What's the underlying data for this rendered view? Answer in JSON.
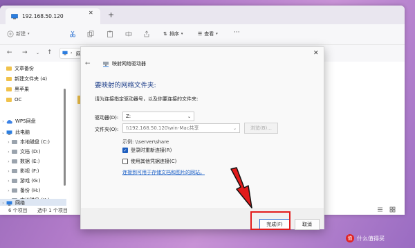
{
  "explorer": {
    "tab_title": "192.168.50.120",
    "new_tab_label": "+",
    "toolbar": {
      "new_label": "新建",
      "sort_label": "排序",
      "view_label": "查看",
      "more_label": "···"
    },
    "breadcrumb_text": "网",
    "sidebar": {
      "items": [
        {
          "label": "文章备份",
          "icon": "folder-icon"
        },
        {
          "label": "新建文件夹 (4)",
          "icon": "folder-icon"
        },
        {
          "label": "黑苹果",
          "icon": "folder-icon"
        },
        {
          "label": "OC",
          "icon": "folder-icon"
        },
        {
          "label": "WPS网盘",
          "icon": "cloud-icon"
        },
        {
          "label": "此电脑",
          "icon": "computer-icon"
        },
        {
          "label": "本地磁盘 (C:)",
          "icon": "drive-icon"
        },
        {
          "label": "文档 (D:)",
          "icon": "drive-icon"
        },
        {
          "label": "数据 (E:)",
          "icon": "drive-icon"
        },
        {
          "label": "影视 (F:)",
          "icon": "drive-icon"
        },
        {
          "label": "游戏 (G:)",
          "icon": "drive-icon"
        },
        {
          "label": "备份 (H:)",
          "icon": "drive-icon"
        },
        {
          "label": "本地磁盘 (K:)",
          "icon": "drive-icon"
        },
        {
          "label": "网络",
          "icon": "network-icon"
        }
      ]
    },
    "status": {
      "item_count": "6 个项目",
      "selected_count": "选中 1 个项目"
    }
  },
  "dialog": {
    "title": "映射网络驱动器",
    "close_glyph": "✕",
    "heading": "要映射的网络文件夹:",
    "instruction": "请为连接指定驱动器号，以及你要连接的文件夹:",
    "drive_label": "驱动器(D):",
    "drive_value": "Z:",
    "folder_label": "文件夹(O):",
    "folder_value": "\\\\192.168.50.120\\win-Mac共享",
    "browse_label": "浏览(B)...",
    "example": "示例: \\\\server\\share",
    "reconnect_label": "登录时重新连接(R)",
    "reconnect_checked": true,
    "other_credentials_label": "使用其他凭据连接(C)",
    "other_credentials_checked": false,
    "link_label": "连接到可用于存储文档和图片的网站。",
    "finish_label": "完成(F)",
    "cancel_label": "取消"
  },
  "watermark": {
    "logo_text": "值",
    "text": "什么值得买"
  },
  "colors": {
    "accent": "#1f5fbf",
    "highlight": "#e21b1b",
    "folder": "#f0c24b"
  }
}
